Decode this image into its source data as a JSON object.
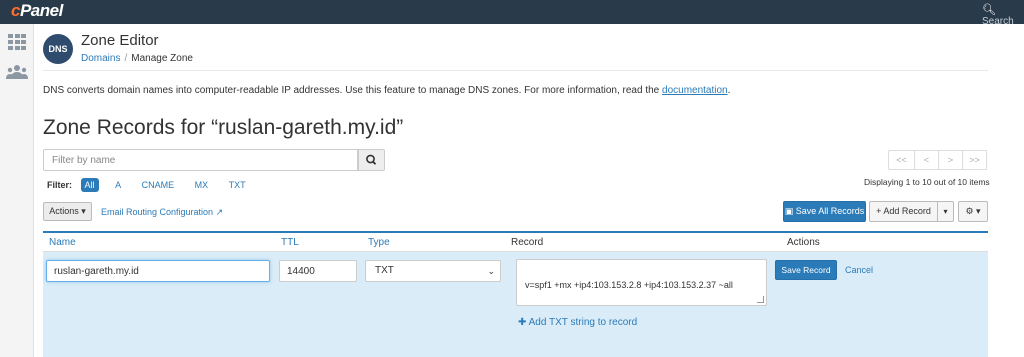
{
  "topbar": {
    "logo": "cPanel",
    "logo_first": "c",
    "logo_rest": "Panel",
    "search_placeholder": "Search"
  },
  "header": {
    "badge": "DNS",
    "title": "Zone Editor",
    "breadcrumb": {
      "parent": "Domains",
      "separator": "/",
      "current": "Manage Zone"
    }
  },
  "intro": {
    "text": "DNS converts domain names into computer-readable IP addresses. Use this feature to manage DNS zones. For more information, read the ",
    "link": "documentation",
    "suffix": "."
  },
  "section_title": "Zone Records for “ruslan-gareth.my.id”",
  "filter": {
    "placeholder": "Filter by name",
    "label": "Filter:",
    "options": [
      "All",
      "A",
      "CNAME",
      "MX",
      "TXT"
    ],
    "active": "All"
  },
  "pager": {
    "first": "<<",
    "prev": "<",
    "next": ">",
    "last": ">>",
    "info": "Displaying 1 to 10 out of 10 items"
  },
  "toolbar": {
    "actions_label": "Actions",
    "email_routing": "Email Routing Configuration",
    "save_all": "Save All Records",
    "add_record": "Add Record"
  },
  "table": {
    "headers": {
      "name": "Name",
      "ttl": "TTL",
      "type": "Type",
      "record": "Record",
      "actions": "Actions"
    },
    "edit_row": {
      "name": "ruslan-gareth.my.id",
      "ttl": "14400",
      "type": "TXT",
      "record": "v=spf1 +mx +ip4:103.153.2.8 +ip4:103.153.2.37 ~all",
      "add_txt": "Add TXT string to record",
      "save": "Save Record",
      "cancel": "Cancel"
    }
  },
  "colors": {
    "topbar": "#293a4a",
    "brand_orange": "#ff6c2c",
    "primary": "#2b7bb9",
    "edit_row_bg": "#d9ecf7"
  }
}
